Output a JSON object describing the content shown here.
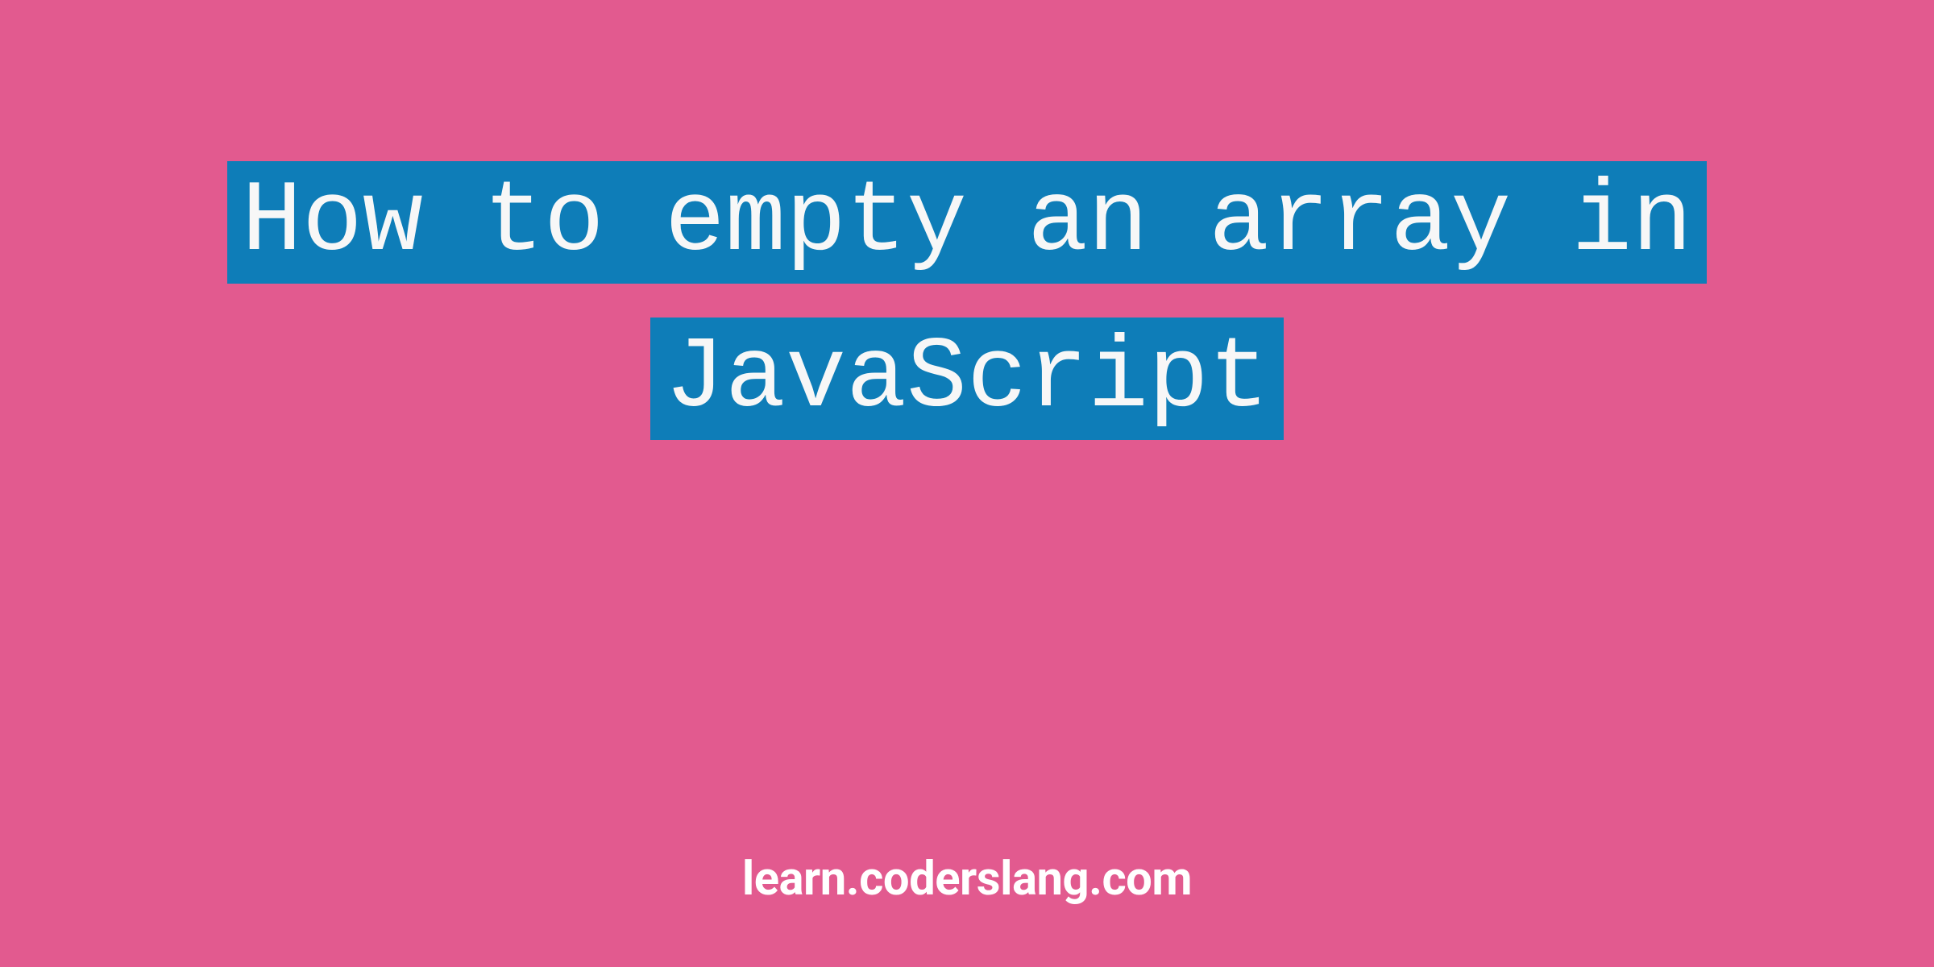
{
  "title": {
    "line1": "How to empty an array in",
    "line2": "JavaScript"
  },
  "footer": {
    "domain": "learn.coderslang.com"
  },
  "colors": {
    "background": "#e25a8f",
    "highlight": "#0e7db8",
    "text": "#f7f7f7"
  }
}
